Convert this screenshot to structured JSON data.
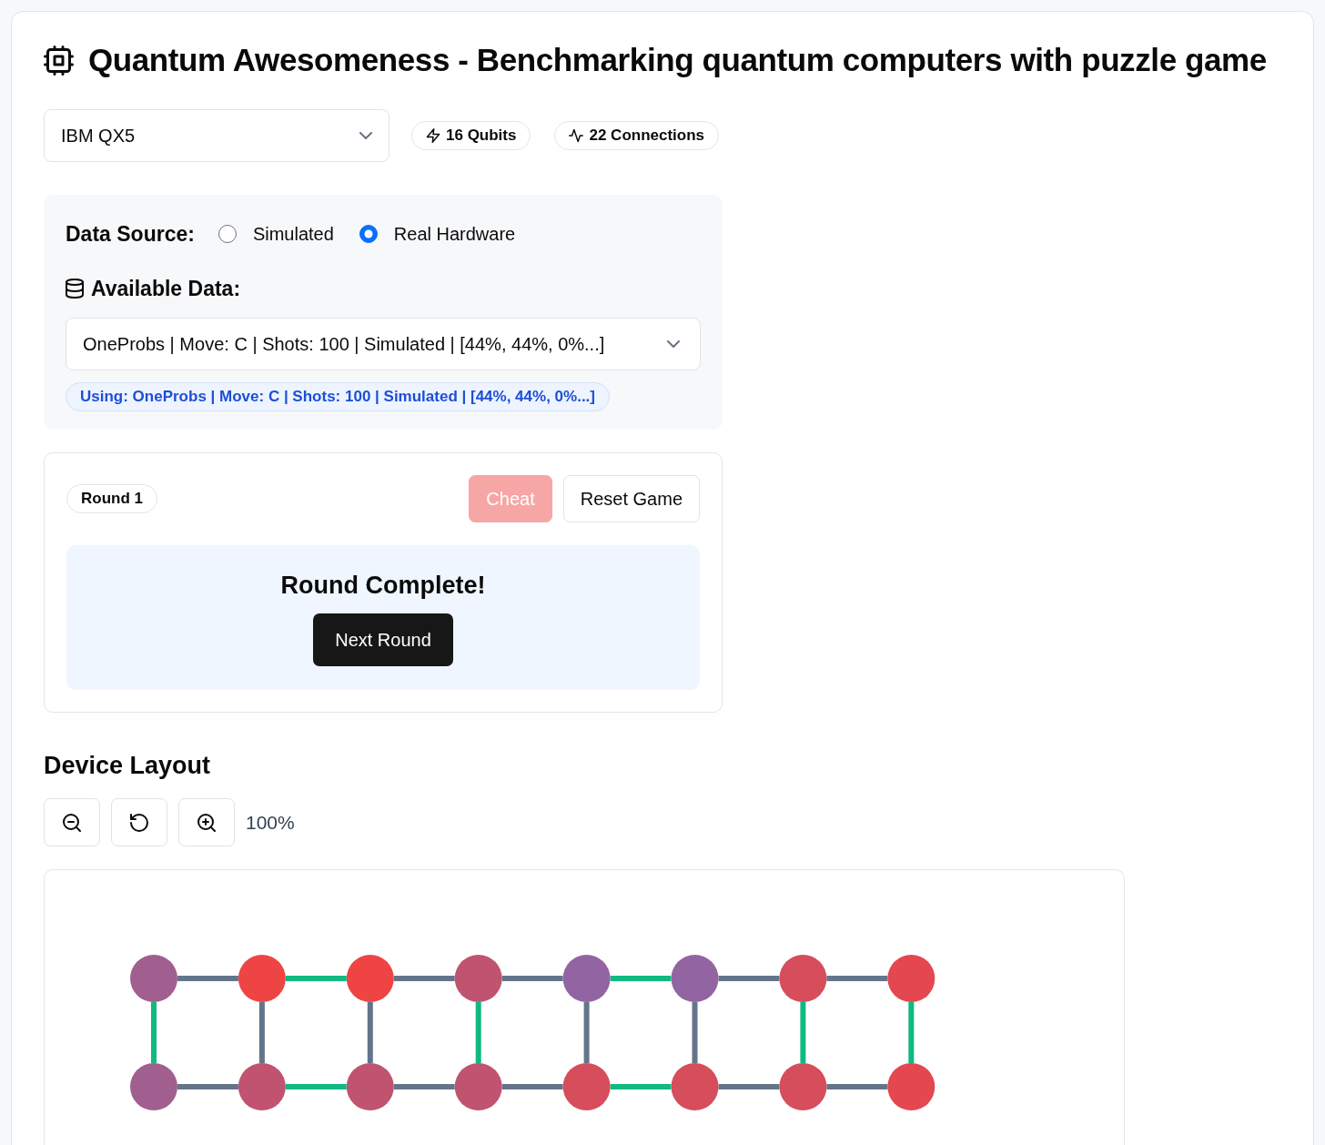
{
  "header": {
    "title": "Quantum Awesomeness - Benchmarking quantum computers with puzzle game"
  },
  "device": {
    "select": {
      "value": "IBM QX5"
    },
    "badges": [
      {
        "kind": "qubits",
        "label": "16 Qubits"
      },
      {
        "kind": "connections",
        "label": "22 Connections"
      }
    ]
  },
  "data_source": {
    "label": "Data Source:",
    "options": [
      {
        "label": "Simulated",
        "selected": false
      },
      {
        "label": "Real Hardware",
        "selected": true
      }
    ],
    "available_label": "Available Data:",
    "select": {
      "value": "OneProbs | Move: C | Shots: 100 | Simulated | [44%, 44%, 0%...]"
    },
    "using_badge": "Using: OneProbs | Move: C | Shots: 100 | Simulated | [44%, 44%, 0%...]"
  },
  "game": {
    "round_badge": "Round 1",
    "buttons": [
      {
        "kind": "danger",
        "label": "Cheat",
        "disabled": true
      },
      {
        "kind": "outline",
        "label": "Reset Game",
        "disabled": false
      }
    ],
    "status": {
      "message": "Round Complete!",
      "button": "Next Round"
    }
  },
  "device_layout": {
    "title": "Device Layout",
    "zoom_controls": [
      {
        "kind": "zoom_out"
      },
      {
        "kind": "reset"
      },
      {
        "kind": "zoom_in"
      }
    ],
    "zoom_reading": "100%",
    "top_row": {
      "nodes": [
        {
          "color": "#a05f8f"
        },
        {
          "color": "#ef4444"
        },
        {
          "color": "#ef4444"
        },
        {
          "color": "#c05470"
        },
        {
          "color": "#9265a2"
        },
        {
          "color": "#9265a2"
        },
        {
          "color": "#d64d5c"
        },
        {
          "color": "#e4474f"
        }
      ],
      "links": [
        {
          "color": "#64748b"
        },
        {
          "color": "#10b981"
        },
        {
          "color": "#64748b"
        },
        {
          "color": "#64748b"
        },
        {
          "color": "#10b981"
        },
        {
          "color": "#64748b"
        },
        {
          "color": "#64748b"
        }
      ]
    },
    "bottom_row": {
      "nodes": [
        {
          "color": "#a05f8f"
        },
        {
          "color": "#c05470"
        },
        {
          "color": "#c05470"
        },
        {
          "color": "#c05470"
        },
        {
          "color": "#d64d5c"
        },
        {
          "color": "#d64d5c"
        },
        {
          "color": "#d64d5c"
        },
        {
          "color": "#e4474f"
        }
      ],
      "links": [
        {
          "color": "#64748b"
        },
        {
          "color": "#10b981"
        },
        {
          "color": "#64748b"
        },
        {
          "color": "#64748b"
        },
        {
          "color": "#10b981"
        },
        {
          "color": "#64748b"
        },
        {
          "color": "#64748b"
        }
      ]
    },
    "rungs": [
      {
        "color": "#10b981"
      },
      {
        "color": "#64748b"
      },
      {
        "color": "#64748b"
      },
      {
        "color": "#10b981"
      },
      {
        "color": "#64748b"
      },
      {
        "color": "#64748b"
      },
      {
        "color": "#10b981"
      },
      {
        "color": "#10b981"
      }
    ]
  }
}
